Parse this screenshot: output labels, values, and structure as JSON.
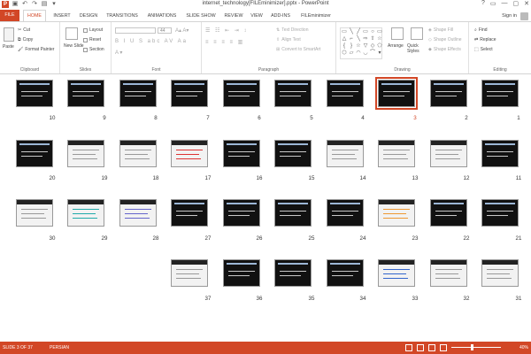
{
  "titlebar": {
    "title": "internet_technology[FILEminimizer].pptx - PowerPoint",
    "qat_icons": [
      "powerpoint-icon",
      "save-icon",
      "undo-icon",
      "redo-icon",
      "present-icon",
      "customize-icon"
    ],
    "controls": [
      "?",
      "▭",
      "—",
      "▢",
      "✕"
    ]
  },
  "tabs": [
    {
      "label": "FILE",
      "name": "tab-file"
    },
    {
      "label": "HOME",
      "name": "tab-home"
    },
    {
      "label": "INSERT",
      "name": "tab-insert"
    },
    {
      "label": "DESIGN",
      "name": "tab-design"
    },
    {
      "label": "TRANSITIONS",
      "name": "tab-transitions"
    },
    {
      "label": "ANIMATIONS",
      "name": "tab-animations"
    },
    {
      "label": "SLIDE SHOW",
      "name": "tab-slide-show"
    },
    {
      "label": "REVIEW",
      "name": "tab-review"
    },
    {
      "label": "VIEW",
      "name": "tab-view"
    },
    {
      "label": "ADD-INS",
      "name": "tab-add-ins"
    },
    {
      "label": "FILEminimizer",
      "name": "tab-fileminimizer"
    }
  ],
  "signin": "Sign in",
  "ribbon": {
    "clipboard": {
      "label": "Clipboard",
      "paste": "Paste",
      "cut": "Cut",
      "copy": "Copy",
      "format_painter": "Format Painter"
    },
    "slides": {
      "label": "Slides",
      "new_slide": "New Slide",
      "layout": "Layout",
      "reset": "Reset",
      "section": "Section"
    },
    "font": {
      "label": "Font",
      "font_size": "44"
    },
    "paragraph": {
      "label": "Paragraph",
      "text_direction": "Text Direction",
      "align_text": "Align Text",
      "convert_smartart": "Convert to SmartArt"
    },
    "drawing": {
      "label": "Drawing",
      "arrange": "Arrange",
      "quick_styles": "Quick Styles",
      "shape_fill": "Shape Fill",
      "shape_outline": "Shape Outline",
      "shape_effects": "Shape Effects"
    },
    "editing": {
      "label": "Editing",
      "find": "Find",
      "replace": "Replace",
      "select": "Select"
    }
  },
  "slides": [
    {
      "n": "10"
    },
    {
      "n": "9"
    },
    {
      "n": "8"
    },
    {
      "n": "7"
    },
    {
      "n": "6"
    },
    {
      "n": "5"
    },
    {
      "n": "4"
    },
    {
      "n": "3"
    },
    {
      "n": "2"
    },
    {
      "n": "1"
    },
    {
      "n": "20"
    },
    {
      "n": "19"
    },
    {
      "n": "18"
    },
    {
      "n": "17"
    },
    {
      "n": "16"
    },
    {
      "n": "15"
    },
    {
      "n": "14"
    },
    {
      "n": "13"
    },
    {
      "n": "12"
    },
    {
      "n": "11"
    },
    {
      "n": "30"
    },
    {
      "n": "29"
    },
    {
      "n": "28"
    },
    {
      "n": "27"
    },
    {
      "n": "26"
    },
    {
      "n": "25"
    },
    {
      "n": "24"
    },
    {
      "n": "23"
    },
    {
      "n": "22"
    },
    {
      "n": "21"
    },
    {
      "n": "37"
    },
    {
      "n": "36"
    },
    {
      "n": "35"
    },
    {
      "n": "34"
    },
    {
      "n": "33"
    },
    {
      "n": "32"
    },
    {
      "n": "31"
    }
  ],
  "selected_slide": "3",
  "status": {
    "slide_info": "SLIDE 3 OF 37",
    "language": "PERSIAN",
    "zoom": "40%"
  }
}
